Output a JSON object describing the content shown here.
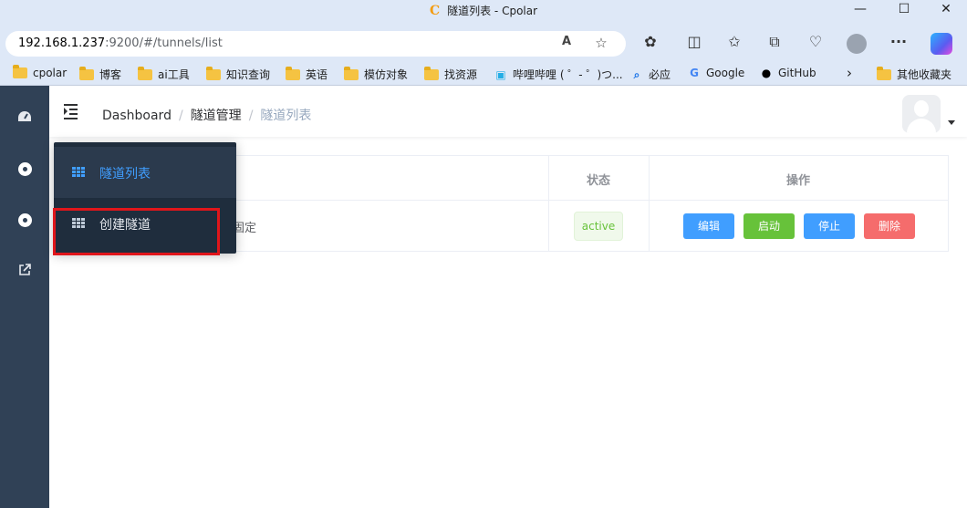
{
  "window": {
    "logo": "C",
    "title": "隧道列表 - Cpolar",
    "controls": [
      "—",
      "☐",
      "✕"
    ]
  },
  "addressbar": {
    "host": "192.168.1.237",
    "path": ":9200/#/tunnels/list",
    "read_aloud_icon": "A",
    "favorite_icon": "☆"
  },
  "toolbar": {
    "extensions_icon": "✿",
    "split_icon": "◫",
    "favorites_icon": "✩",
    "collections_icon": "⧉",
    "health_icon": "♡",
    "more_icon": "···"
  },
  "bookmarks": [
    {
      "label": "cpolar",
      "icon": "folder"
    },
    {
      "label": "博客",
      "icon": "folder"
    },
    {
      "label": "ai工具",
      "icon": "folder"
    },
    {
      "label": "知识查询",
      "icon": "folder"
    },
    {
      "label": "英语",
      "icon": "folder"
    },
    {
      "label": "模仿对象",
      "icon": "folder"
    },
    {
      "label": "找资源",
      "icon": "folder"
    },
    {
      "label": "哔哩哔哩 ( ゜- ゜)つ...",
      "icon": "bilibili"
    },
    {
      "label": "必应",
      "icon": "search"
    },
    {
      "label": "Google",
      "icon": "google"
    },
    {
      "label": "GitHub",
      "icon": "github"
    }
  ],
  "bookmarks_more": "›",
  "bookmarks_other": "其他收藏夹",
  "navbar": {
    "breadcrumb": [
      "Dashboard",
      "隧道管理",
      "隧道列表"
    ],
    "separator": "/"
  },
  "table": {
    "headers": {
      "status": "状态",
      "actions": "操作"
    },
    "rows": [
      {
        "name_fragment": "固定",
        "status": "active"
      }
    ],
    "actions": {
      "edit": "编辑",
      "start": "启动",
      "stop": "停止",
      "delete": "删除"
    }
  },
  "submenu": {
    "items": [
      {
        "label": "隧道列表",
        "active": true
      },
      {
        "label": "创建隧道",
        "active": false
      }
    ]
  },
  "colors": {
    "sidebar": "#304156",
    "submenu": "#1f2d3d",
    "active_text": "#409eff",
    "primary": "#409eff",
    "success": "#67c23a",
    "danger": "#f56c6c",
    "highlight": "#e0161b"
  }
}
